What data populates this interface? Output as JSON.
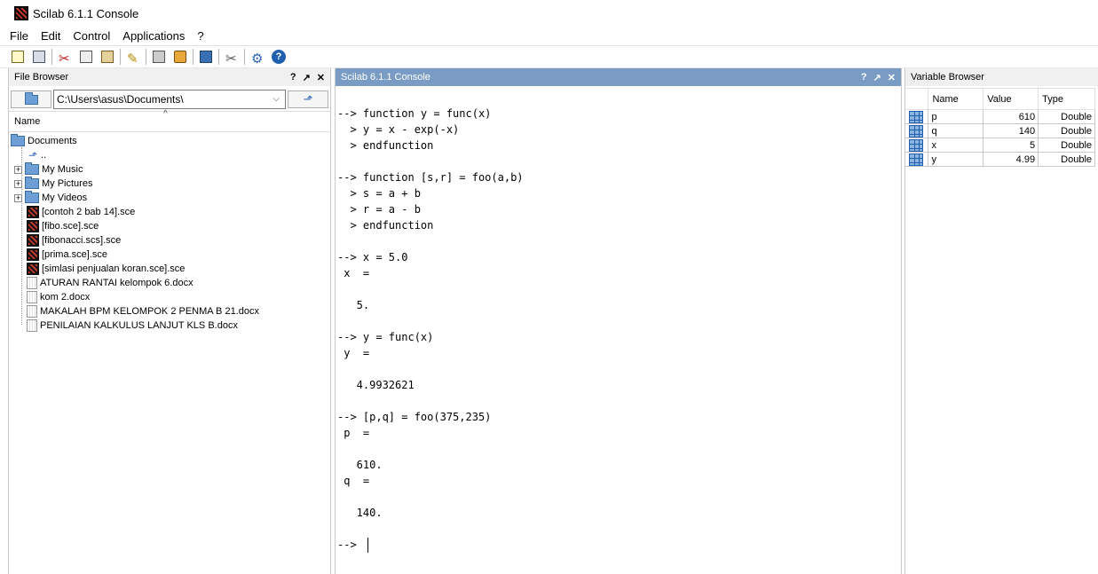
{
  "window": {
    "title": "Scilab 6.1.1 Console"
  },
  "menu": [
    "File",
    "Edit",
    "Control",
    "Applications",
    "?"
  ],
  "toolbar": {
    "icons": [
      "new-script-icon",
      "open-file-icon",
      "cut-icon",
      "copy-icon",
      "paste-icon",
      "clear-console-icon",
      "print-icon",
      "dock-icon",
      "variable-browser-icon",
      "module-manager-icon",
      "preferences-icon",
      "help-icon"
    ]
  },
  "file_browser": {
    "title": "File Browser",
    "controls": [
      "?",
      "↗",
      "✕"
    ],
    "path": "C:\\Users\\asus\\Documents\\",
    "column": "Name",
    "root": "Documents",
    "parent": "..",
    "folders": [
      "My Music",
      "My Pictures",
      "My Videos"
    ],
    "sce_files": [
      "[contoh 2 bab 14].sce",
      "[fibo.sce].sce",
      "[fibonacci.scs].sce",
      "[prima.sce].sce",
      "[simlasi penjualan koran.sce].sce"
    ],
    "doc_files": [
      "ATURAN RANTAI kelompok 6.docx",
      "kom 2.docx",
      "MAKALAH BPM KELOMPOK 2 PENMA B 21.docx",
      "PENILAIAN KALKULUS LANJUT KLS B.docx"
    ]
  },
  "console": {
    "title": "Scilab 6.1.1 Console",
    "controls": [
      "?",
      "↗",
      "✕"
    ],
    "lines": [
      "--> function y = func(x)",
      "  > y = x - exp(-x)",
      "  > endfunction",
      "",
      "--> function [s,r] = foo(a,b)",
      "  > s = a + b",
      "  > r = a - b",
      "  > endfunction",
      "",
      "--> x = 5.0",
      " x  =",
      "",
      "   5.",
      "",
      "--> y = func(x)",
      " y  =",
      "",
      "   4.9932621",
      "",
      "--> [p,q] = foo(375,235)",
      " p  =",
      "",
      "   610.",
      " q  =",
      "",
      "   140.",
      ""
    ],
    "prompt": "--> "
  },
  "variable_browser": {
    "title": "Variable Browser",
    "columns": [
      "Name",
      "Value",
      "Type"
    ],
    "rows": [
      {
        "name": "p",
        "value": "610",
        "type": "Double"
      },
      {
        "name": "q",
        "value": "140",
        "type": "Double"
      },
      {
        "name": "x",
        "value": "5",
        "type": "Double"
      },
      {
        "name": "y",
        "value": "4.99",
        "type": "Double"
      }
    ]
  }
}
